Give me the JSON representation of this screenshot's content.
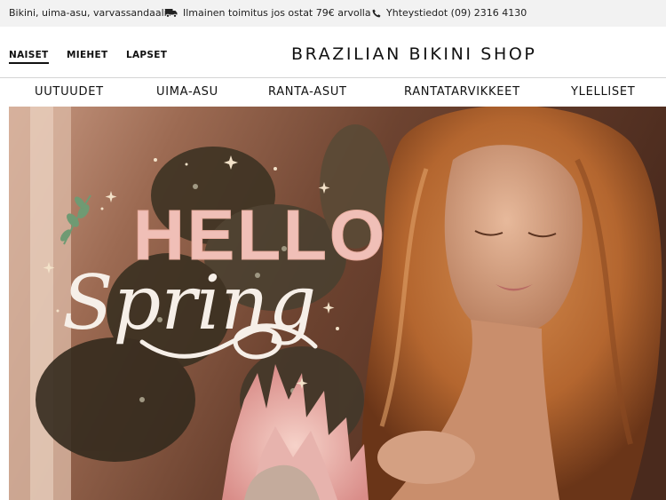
{
  "topbar": {
    "tagline": "Bikini, uima-asu, varvassandaalit",
    "shipping": "Ilmainen toimitus jos ostat 79€ arvolla",
    "contact": "Yhteystiedot (09) 2316 4130",
    "shipping_icon": "truck-icon",
    "contact_icon": "phone-icon"
  },
  "gender_tabs": {
    "women": "NAISET",
    "men": "MIEHET",
    "kids": "LAPSET",
    "active": "NAISET"
  },
  "logo": "BRAZILIAN BIKINI SHOP",
  "nav": {
    "items": [
      "UUTUUDET",
      "UIMA-ASU",
      "RANTA-ASUT",
      "RANTATARVIKKEET",
      "YLELLISET"
    ]
  },
  "hero": {
    "headline": "HELLO",
    "script_word": "Spring",
    "colors": {
      "pink": "#f0bfb7",
      "cream": "#f6efe8",
      "leaf": "#6f9a73",
      "warm_bg": "#a8735a"
    }
  }
}
